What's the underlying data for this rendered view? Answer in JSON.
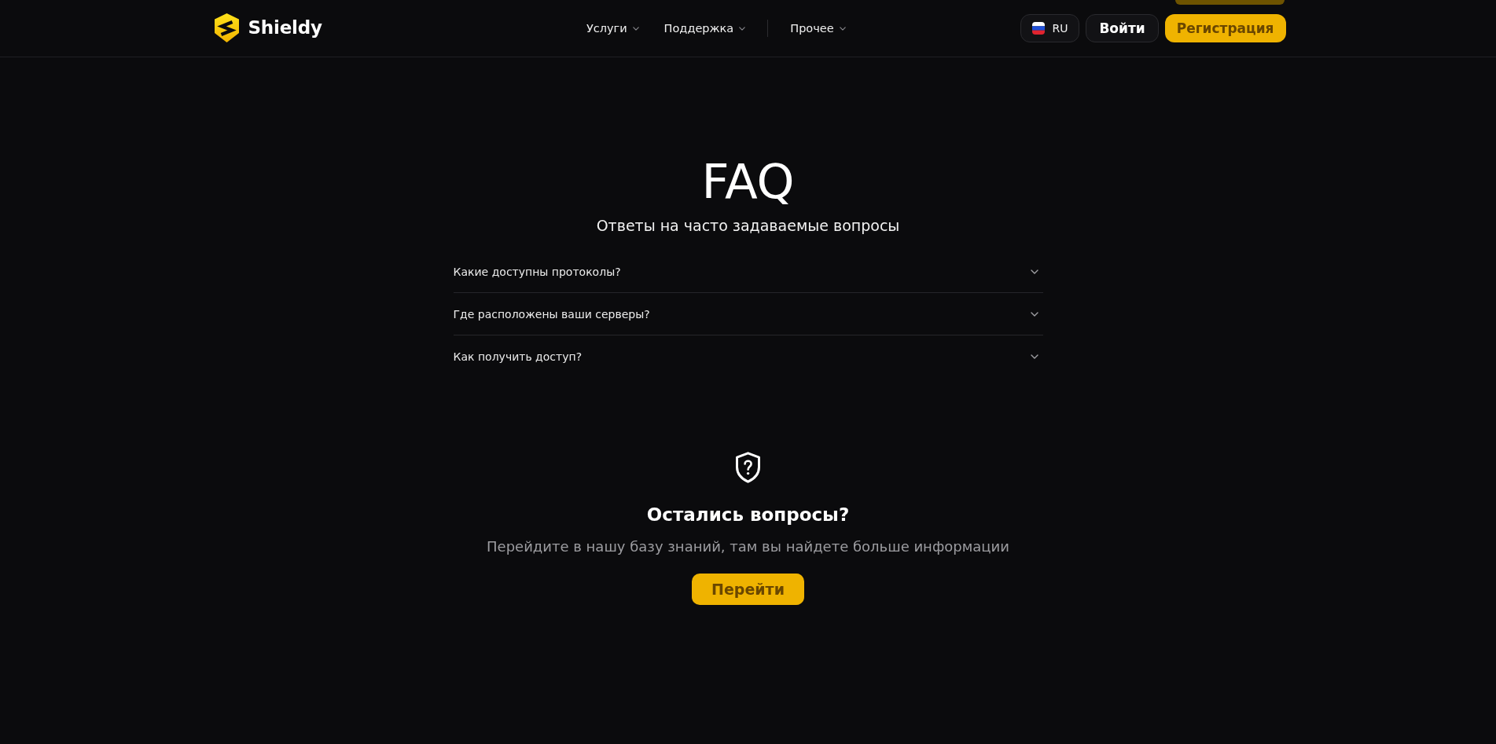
{
  "header": {
    "logo": {
      "text": "Shieldy"
    },
    "nav": [
      {
        "kind": "menu",
        "label": "Услуги",
        "expanded": false
      },
      {
        "kind": "menu",
        "label": "Поддержка",
        "expanded": false
      },
      {
        "kind": "separator"
      },
      {
        "kind": "menu",
        "label": "Прочее",
        "expanded": false
      }
    ],
    "language": {
      "code": "RU"
    },
    "login_button": "Войти",
    "register_button": "Регистрация"
  },
  "faq": {
    "title": "FAQ",
    "subtitle": "Ответы на часто задаваемые вопросы",
    "items": [
      {
        "question": "Какие доступны протоколы?",
        "expanded": false
      },
      {
        "question": "Где расположены ваши серверы?",
        "expanded": false
      },
      {
        "question": "Как получить доступ?",
        "expanded": false
      }
    ]
  },
  "help": {
    "title": "Остались вопросы?",
    "text": "Перейдите в нашу базу знаний, там вы найдете больше информации",
    "button": "Перейти"
  }
}
